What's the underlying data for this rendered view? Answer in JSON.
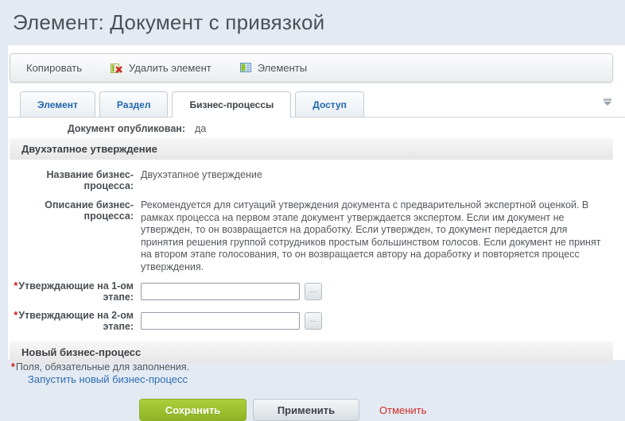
{
  "title": "Элемент: Документ с привязкой",
  "toolbar": {
    "copy": "Копировать",
    "delete": "Удалить элемент",
    "elements": "Элементы",
    "icons": [
      "delete-element-icon",
      "elements-list-icon"
    ]
  },
  "tabs": {
    "items": [
      {
        "label": "Элемент",
        "active": false
      },
      {
        "label": "Раздел",
        "active": false
      },
      {
        "label": "Бизнес-процессы",
        "active": true
      },
      {
        "label": "Доступ",
        "active": false
      }
    ],
    "active_tab": "Бизнес-процессы",
    "menu_icon": "chevron-down-icon"
  },
  "fields": {
    "published": {
      "label": "Документ опубликован:",
      "value": "да"
    },
    "bp_name": {
      "label": "Название бизнес-процесса:",
      "value": "Двухэтапное утверждение"
    },
    "bp_desc": {
      "label": "Описание бизнес-процесса:",
      "value": "Рекомендуется для ситуаций утверждения документа с предварительной экспертной оценкой. В рамках процесса на первом этапе документ утверждается экспертом. Если им документ не утвержден, то он возвращается на доработку. Если утвержден, то документ передается для принятия решения группой сотрудников простым большинством голосов. Если документ не принят на втором этапе голосования, то он возвращается автору на доработку и повторяется процесс утверждения."
    },
    "approvers1": {
      "label": "Утверждающие на 1-ом этапе:",
      "value": "",
      "required": true,
      "browse_label": "..."
    },
    "approvers2": {
      "label": "Утверждающие на 2-ом этапе:",
      "value": "",
      "required": true,
      "browse_label": "..."
    }
  },
  "sections": {
    "two_stage": "Двухэтапное утверждение",
    "new_bizproc": "Новый бизнес-процесс"
  },
  "links": {
    "start_new_bizproc": "Запустить новый бизнес-процесс"
  },
  "buttons": {
    "save": "Сохранить",
    "apply": "Применить",
    "cancel": "Отменить"
  },
  "footer": {
    "required_mark": "*",
    "note": "Поля, обязательные для заполнения."
  },
  "marks": {
    "required": "*"
  },
  "colors": {
    "page_bg": "#e3eaf1",
    "accent_green": "#8fb425",
    "link_blue": "#2d6db5",
    "required_red": "#cc1111",
    "cancel_red": "#d32a2a"
  }
}
